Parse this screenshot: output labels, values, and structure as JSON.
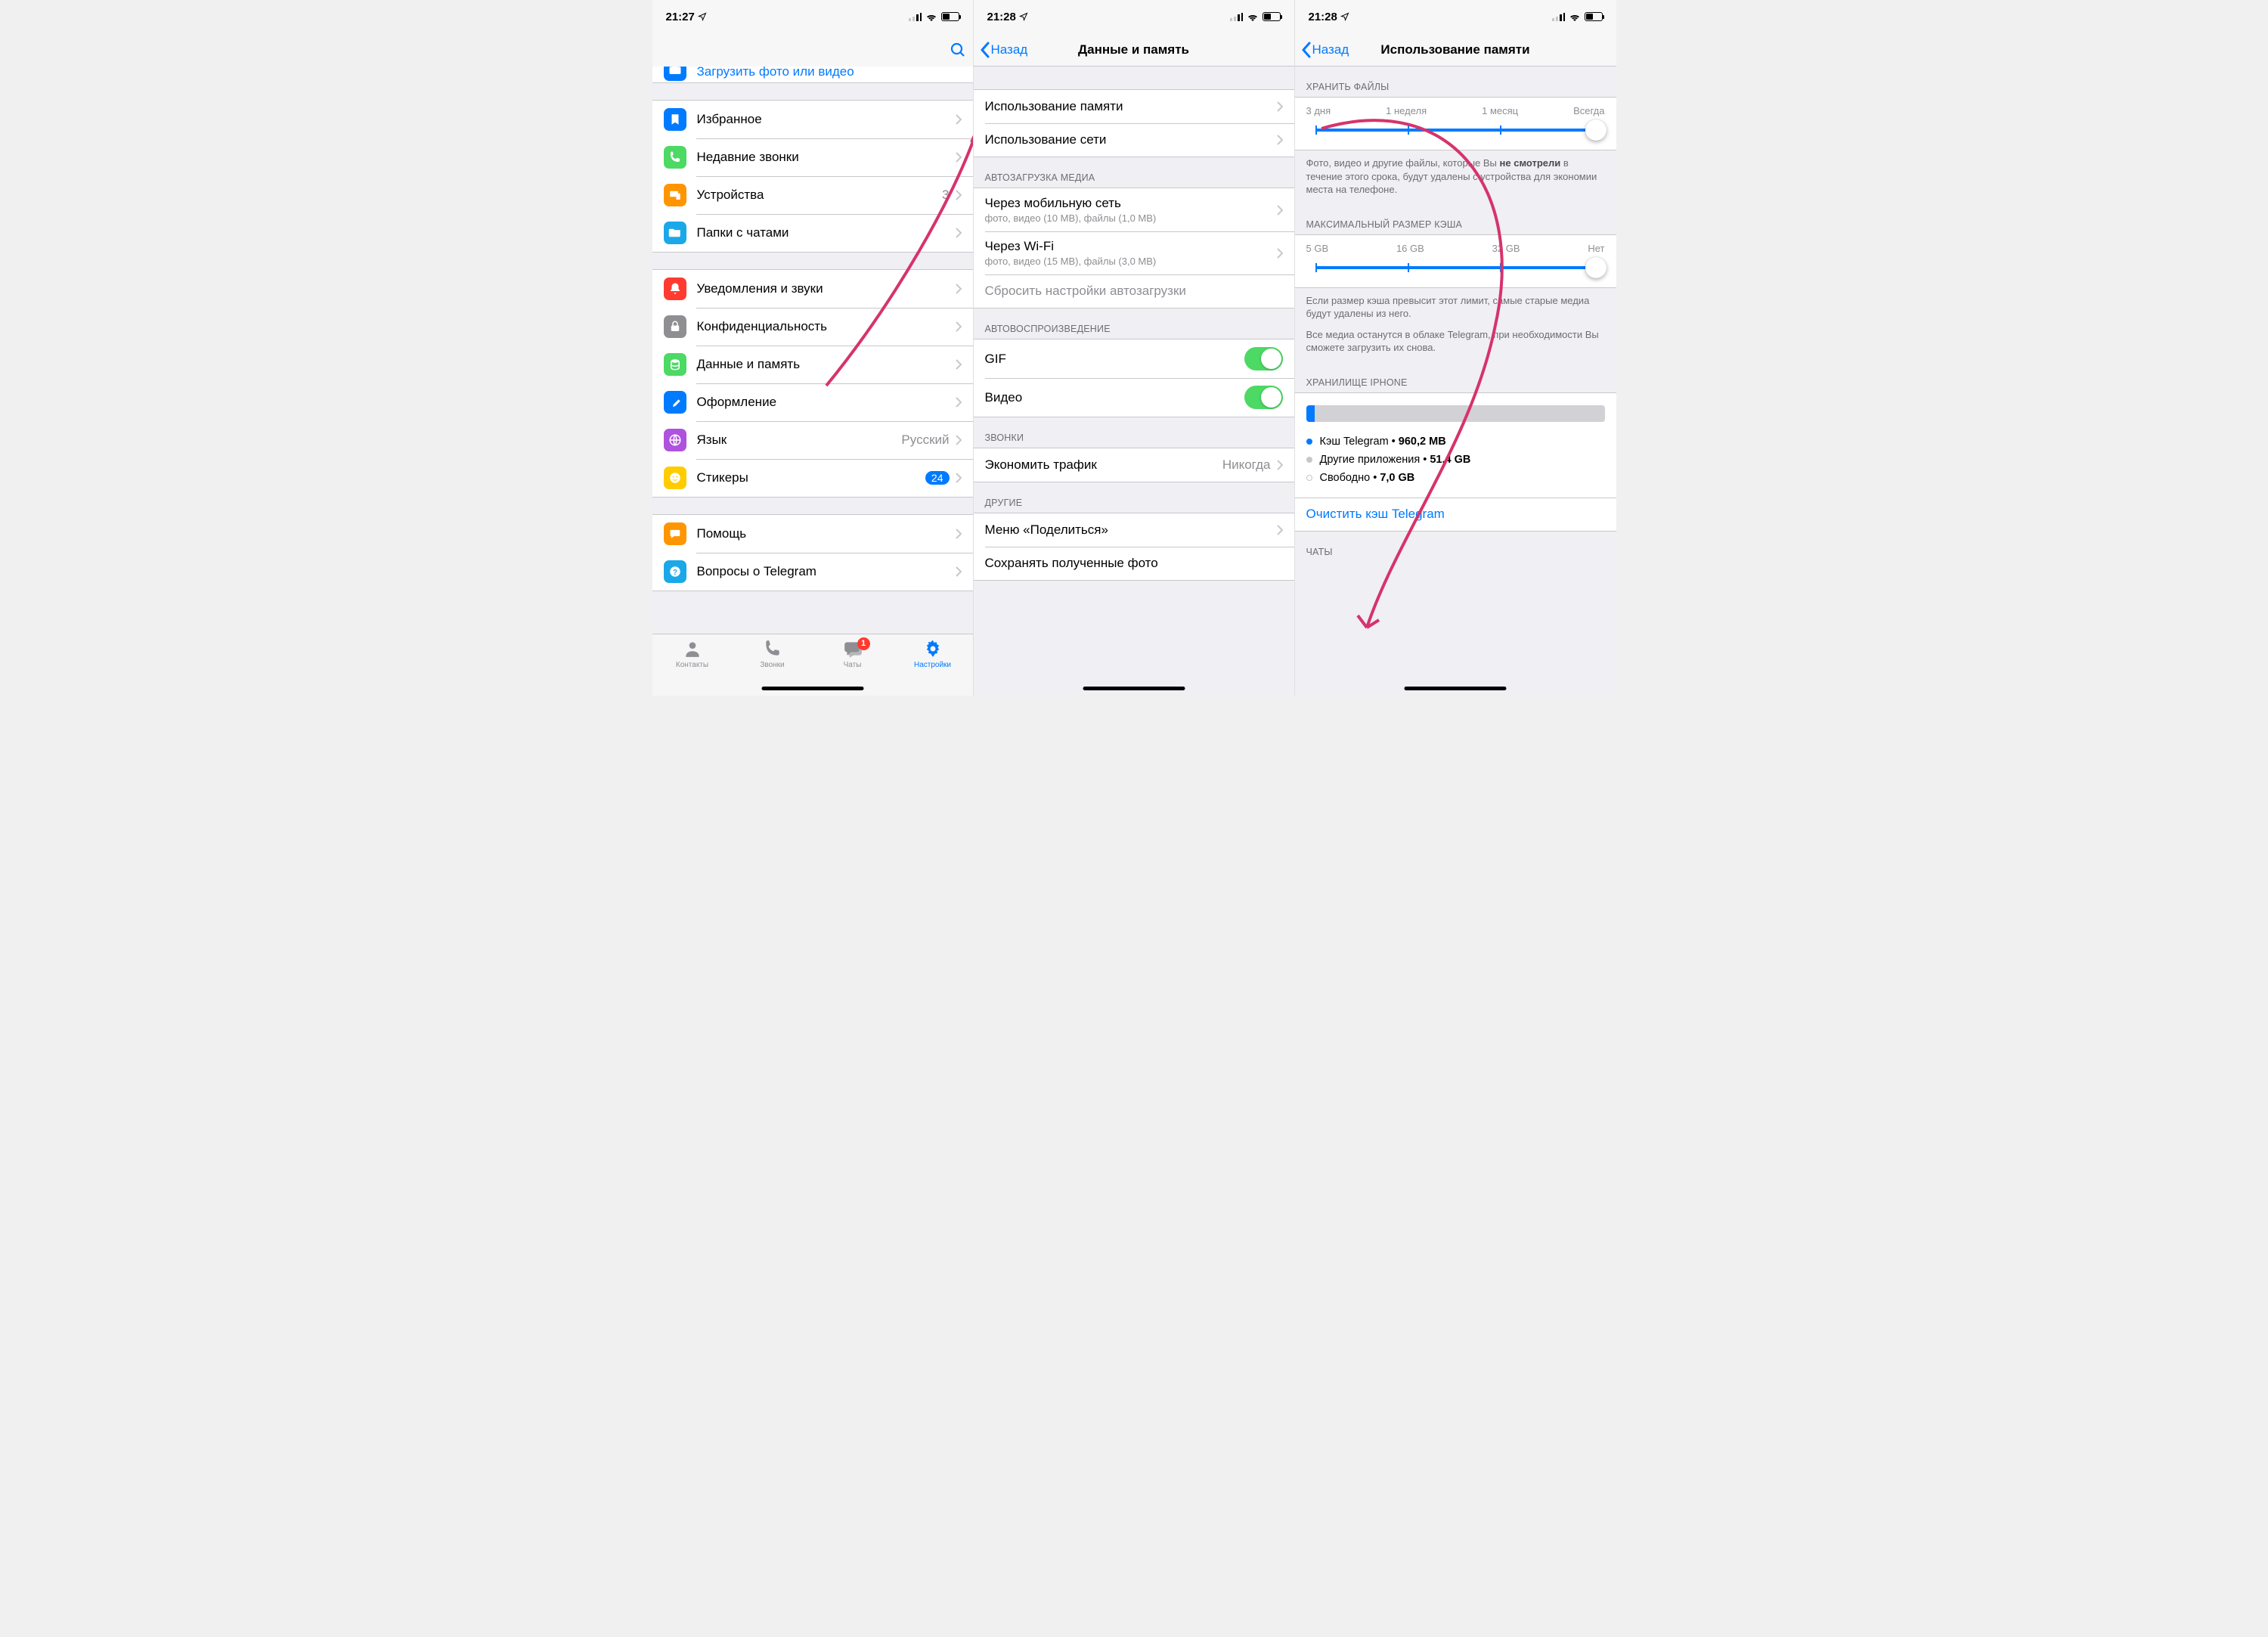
{
  "statusbar": {
    "time_a": "21:27",
    "time_b": "21:28"
  },
  "screen1": {
    "partial_top_label": "Загрузить фото или видео",
    "group1": [
      {
        "icon": "bookmark",
        "color": "#007aff",
        "label": "Избранное"
      },
      {
        "icon": "phone",
        "color": "#4cd964",
        "label": "Недавние звонки"
      },
      {
        "icon": "devices",
        "color": "#ff9500",
        "label": "Устройства",
        "detail": "3"
      },
      {
        "icon": "folder",
        "color": "#1AA8E8",
        "label": "Папки с чатами"
      }
    ],
    "group2": [
      {
        "icon": "bell",
        "color": "#ff3b30",
        "label": "Уведомления и звуки"
      },
      {
        "icon": "lock",
        "color": "#8e8e93",
        "label": "Конфиденциальность"
      },
      {
        "icon": "data",
        "color": "#4cd964",
        "label": "Данные и память"
      },
      {
        "icon": "brush",
        "color": "#007aff",
        "label": "Оформление"
      },
      {
        "icon": "globe",
        "color": "#af52de",
        "label": "Язык",
        "detail": "Русский"
      },
      {
        "icon": "sticker",
        "color": "#ffcc00",
        "label": "Стикеры",
        "badge": "24"
      }
    ],
    "group3": [
      {
        "icon": "chat",
        "color": "#ff9500",
        "label": "Помощь"
      },
      {
        "icon": "faq",
        "color": "#1AA8E8",
        "label": "Вопросы о Telegram"
      }
    ],
    "tabs": {
      "contacts": "Контакты",
      "calls": "Звонки",
      "chats": "Чаты",
      "chats_badge": "1",
      "settings": "Настройки"
    }
  },
  "screen2": {
    "nav_back": "Назад",
    "nav_title": "Данные и память",
    "group_mem": [
      {
        "label": "Использование памяти"
      },
      {
        "label": "Использование сети"
      }
    ],
    "h_autodl": "АВТОЗАГРУЗКА МЕДИА",
    "autodl": [
      {
        "label": "Через мобильную сеть",
        "sub": "фото, видео (10 MB), файлы (1,0 MB)"
      },
      {
        "label": "Через Wi-Fi",
        "sub": "фото, видео (15 MB), файлы (3,0 MB)"
      }
    ],
    "autodl_reset": "Сбросить настройки автозагрузки",
    "h_autoplay": "АВТОВОСПРОИЗВЕДЕНИЕ",
    "autoplay": [
      {
        "label": "GIF"
      },
      {
        "label": "Видео"
      }
    ],
    "h_calls": "ЗВОНКИ",
    "calls": {
      "label": "Экономить трафик",
      "detail": "Никогда"
    },
    "h_other": "ДРУГИЕ",
    "other": [
      {
        "label": "Меню «Поделиться»"
      },
      {
        "label": "Сохранять полученные фото"
      }
    ]
  },
  "screen3": {
    "nav_back": "Назад",
    "nav_title": "Использование памяти",
    "h_keep": "ХРАНИТЬ ФАЙЛЫ",
    "keep_ticks": [
      "3 дня",
      "1 неделя",
      "1 месяц",
      "Всегда"
    ],
    "keep_footer_a": "Фото, видео и другие файлы, которые Вы ",
    "keep_footer_b": "не смотрели",
    "keep_footer_c": " в течение этого срока, будут удалены с устройства для экономии места на телефоне.",
    "h_max": "МАКСИМАЛЬНЫЙ РАЗМЕР КЭША",
    "max_ticks": [
      "5 GB",
      "16 GB",
      "32 GB",
      "Нет"
    ],
    "max_footer_a": "Если размер кэша превысит этот лимит, самые старые медиа будут удалены из него.",
    "max_footer_b": "Все медиа останутся в облаке Telegram, при необходимости Вы сможете загрузить их снова.",
    "h_storage": "ХРАНИЛИЩЕ IPHONE",
    "legend": [
      {
        "color": "#007aff",
        "name": "Кэш Telegram",
        "value": "960,2 MB"
      },
      {
        "color": "#c7c7cc",
        "name": "Другие приложения",
        "value": "51,4 GB"
      },
      {
        "color": "#ffffff",
        "name": "Свободно",
        "value": "7,0 GB"
      }
    ],
    "clear_link": "Очистить кэш Telegram",
    "h_chats": "ЧАТЫ"
  }
}
